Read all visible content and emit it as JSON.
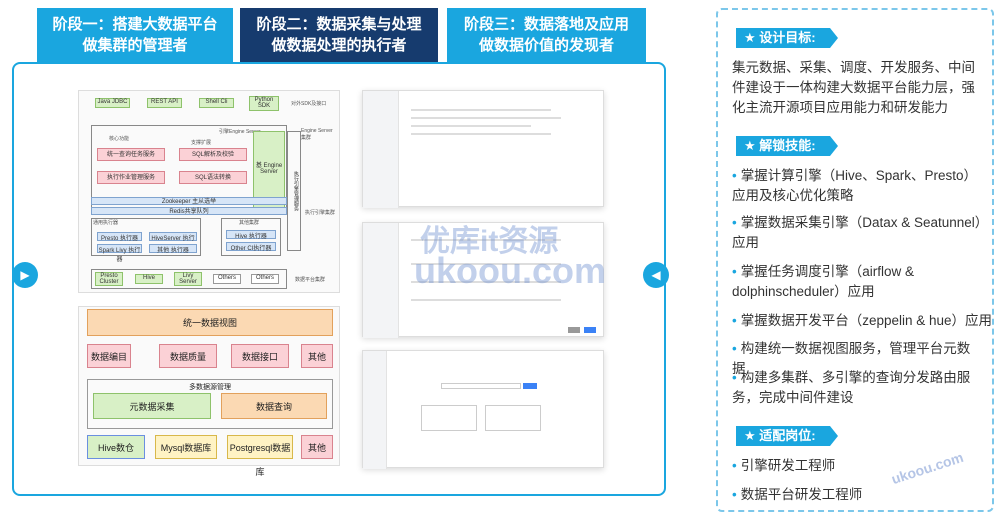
{
  "stages": [
    {
      "line1": "阶段一：搭建大数据平台",
      "line2": "做集群的管理者"
    },
    {
      "line1": "阶段二：数据采集与处理",
      "line2": "做数据处理的执行者"
    },
    {
      "line1": "阶段三：数据落地及应用",
      "line2": "做数据价值的发现者"
    }
  ],
  "nav": {
    "left": "▶",
    "right": "◀"
  },
  "diagram1": {
    "top_boxes": [
      "Java JDBC",
      "REST API",
      "Shell Cli",
      "Python SDK"
    ],
    "top_label": "对外SDK及接口",
    "engine_server": "引擎Engine Server",
    "engine_server_group": "Engine Server 集群",
    "core_label": "核心功能",
    "core_boxes": [
      "统一查询任务服务",
      "执行作业管理服务"
    ],
    "support_label": "支撑扩展",
    "support_boxes": [
      "SQL解析及校验",
      "SQL语法转换"
    ],
    "engine_box": "基 Engine Server",
    "exec_cluster": "执行引擎集群",
    "exec_manager": "执行引擎管理服务",
    "zk": "Zookeeper 主从选举",
    "redis": "Redis共享队列",
    "common_label": "通用执行器",
    "common_boxes": [
      "Presto 执行器",
      "HiveServer 执行器",
      "Spark Livy 执行器",
      "其他 执行器"
    ],
    "other_label": "其他集群",
    "other_boxes": [
      "Hive 执行器",
      "Other CI执行器"
    ],
    "bottom_boxes": [
      "Presto Cluster",
      "Hive",
      "Livy Server",
      "Others",
      "Others"
    ],
    "bottom_label": "数据平台集群"
  },
  "diagram2": {
    "header": "统一数据视图",
    "row1": [
      "数据编目",
      "数据质量",
      "数据接口",
      "其他"
    ],
    "multi_label": "多数据源管理",
    "row2": [
      "元数据采集",
      "数据查询"
    ],
    "row3": [
      "Hive数仓",
      "Mysql数据库",
      "Postgresql数据库",
      "其他"
    ]
  },
  "right": {
    "goal_title": "设计目标:",
    "goal_text": "集元数据、采集、调度、开发服务、中间件建设于一体构建大数据平台能力层，强化主流开源项目应用能力和研发能力",
    "skills_title": "解锁技能:",
    "skills": [
      "掌握计算引擎（Hive、Spark、Presto）应用及核心优化策略",
      "掌握数据采集引擎（Datax & Seatunnel）应用",
      "掌握任务调度引擎（airflow & dolphinscheduler）应用",
      "掌握数据开发平台（zeppelin & hue）应用",
      "构建统一数据视图服务，管理平台元数据",
      "构建多集群、多引擎的查询分发路由服务，完成中间件建设"
    ],
    "jobs_title": "适配岗位:",
    "jobs": [
      "引擎研发工程师",
      "数据平台研发工程师"
    ]
  },
  "watermark": {
    "line1": "优库it资源",
    "line2": "ukoou.com",
    "corner": "ukoou.com"
  }
}
